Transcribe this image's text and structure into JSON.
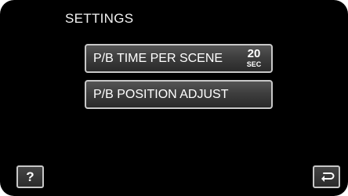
{
  "screen": {
    "title": "SETTINGS"
  },
  "menu": {
    "items": [
      {
        "label": "P/B TIME PER SCENE",
        "value": "20",
        "unit": "SEC"
      },
      {
        "label": "P/B POSITION ADJUST"
      }
    ]
  },
  "footer": {
    "help_symbol": "?",
    "help_icon": "question-mark-icon",
    "back_icon": "return-arrow-icon"
  },
  "colors": {
    "background": "#000000",
    "text": "#ffffff",
    "button_border": "#c8c8c8"
  }
}
